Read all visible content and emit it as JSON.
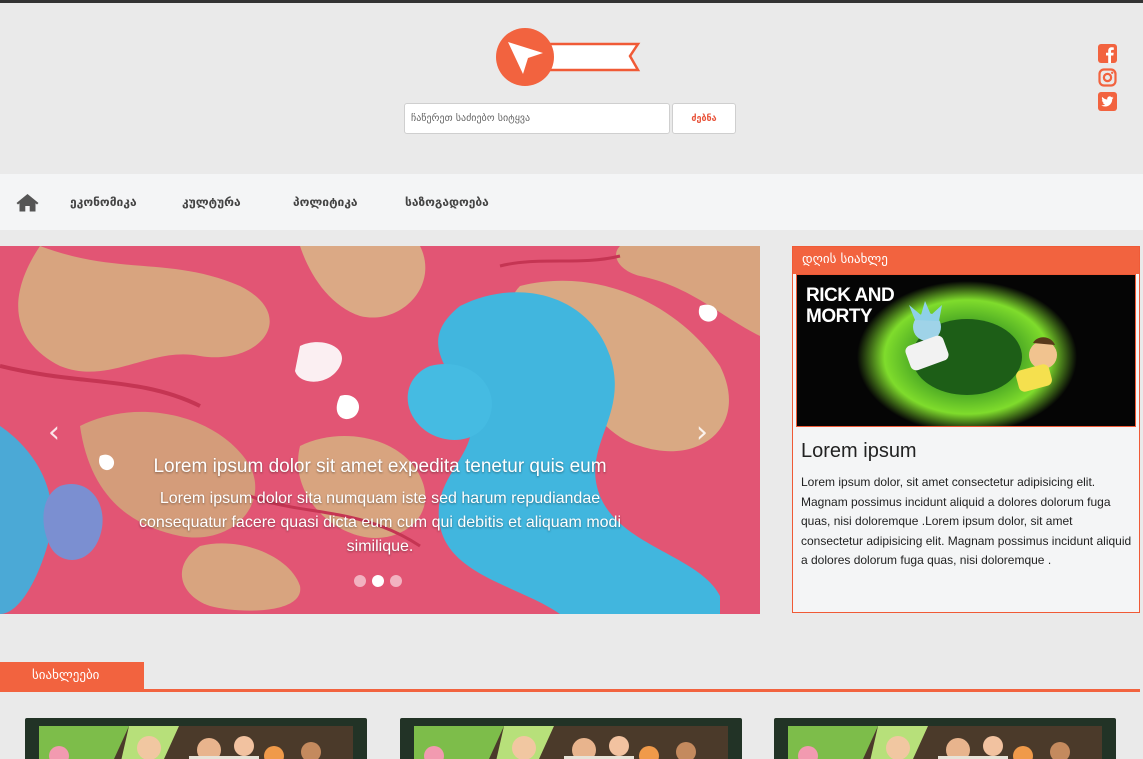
{
  "brand": {
    "logo_icon": "cursor-arrow-icon",
    "accent_color": "#f2633f"
  },
  "search": {
    "placeholder": "ჩაწერეთ საძიებო სიტყვა",
    "button_label": "ძებნა"
  },
  "social": [
    {
      "icon": "facebook-icon"
    },
    {
      "icon": "instagram-icon"
    },
    {
      "icon": "twitter-icon"
    }
  ],
  "nav": {
    "home_icon": "home-icon",
    "items": [
      {
        "label": "ეკონომიკა"
      },
      {
        "label": "კულტურა"
      },
      {
        "label": "პოლიტიკა"
      },
      {
        "label": "საზოგადოება"
      }
    ]
  },
  "carousel": {
    "prev_icon": "chevron-left-icon",
    "next_icon": "chevron-right-icon",
    "prev_glyph": "‹",
    "next_glyph": "›",
    "caption_title": "Lorem ipsum dolor sit amet expedita tenetur quis eum",
    "caption_text": "Lorem ipsum dolor sita numquam iste sed harum repudiandae consequatur facere quasi dicta eum cum qui debitis et aliquam modi similique.",
    "slide_count": 3,
    "active_slide": 2
  },
  "daily": {
    "header": "დღის სიახლე",
    "image_title_line1": "RICK AND",
    "image_title_line2": "MORTY",
    "title": "Lorem ipsum",
    "text": "Lorem ipsum dolor, sit amet consectetur adipisicing elit. Magnam possimus incidunt aliquid a dolores dolorum fuga quas, nisi doloremque .Lorem ipsum dolor, sit amet consectetur adipisicing elit. Magnam possimus incidunt aliquid a dolores dolorum fuga quas, nisi doloremque ."
  },
  "news": {
    "section_label": "სიახლეები",
    "card_count": 3
  }
}
